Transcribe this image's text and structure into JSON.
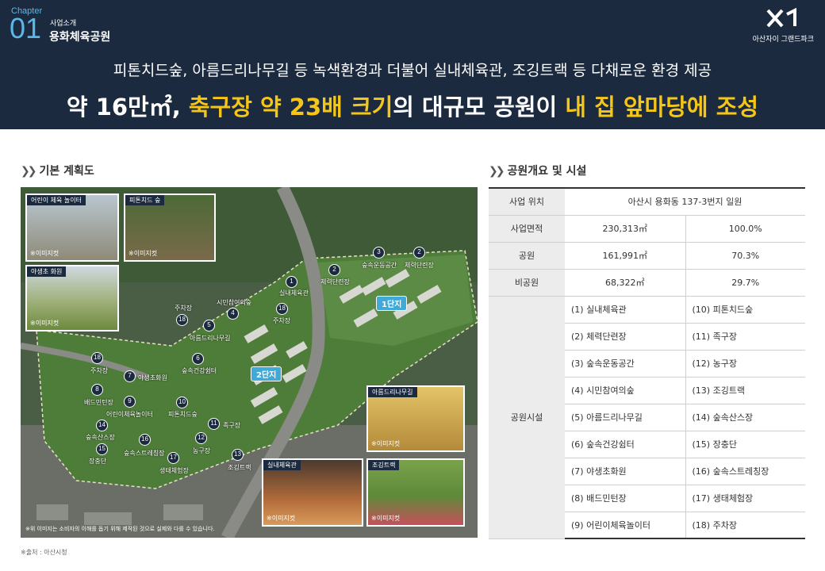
{
  "header": {
    "chapter_label": "Chapter",
    "chapter_num": "01",
    "chapter_sub": "사업소개",
    "chapter_title": "용화체육공원",
    "logo_sub": "아산자이 그랜드파크",
    "headline1": "피톤치드숲, 아름드리나무길 등 녹색환경과 더불어 실내체육관, 조깅트랙 등 다채로운 환경 제공",
    "headline2_a": "약 16만㎡, ",
    "headline2_b": "축구장 약 23배 크기",
    "headline2_c": "의 대규모 공원이 ",
    "headline2_d": "내 집 앞마당에 조성"
  },
  "colors": {
    "header_bg": "#1b2a3e",
    "accent_blue": "#5ab7e8",
    "highlight": "#f5c518",
    "complex_badge": "#3fa9d8"
  },
  "sections": {
    "left_title": "기본 계획도",
    "right_title": "공원개요 및 시설"
  },
  "map": {
    "photos": [
      {
        "tag": "어린이 체육 놀이터",
        "note": "※이미지컷"
      },
      {
        "tag": "피톤치드 숲",
        "note": "※이미지컷"
      },
      {
        "tag": "야생초 화원",
        "note": "※이미지컷"
      },
      {
        "tag": "아름드리나무길",
        "note": "※이미지컷"
      },
      {
        "tag": "실내체육관",
        "note": "※이미지컷"
      },
      {
        "tag": "조깅트랙",
        "note": "※이미지컷"
      }
    ],
    "complexes": [
      "1단지",
      "2단지"
    ],
    "markers": [
      {
        "n": "1",
        "label": "실내체육관"
      },
      {
        "n": "2",
        "label": "체력단련장"
      },
      {
        "n": "3",
        "label": "숲속운동공간"
      },
      {
        "n": "2",
        "label": "체력단련장"
      },
      {
        "n": "4",
        "label": "시민참여의숲"
      },
      {
        "n": "5",
        "label": "아름드리나무길"
      },
      {
        "n": "18",
        "label": "주차장"
      },
      {
        "n": "18",
        "label": "주차장"
      },
      {
        "n": "6",
        "label": "숲속건강쉼터"
      },
      {
        "n": "18",
        "label": "주차장"
      },
      {
        "n": "7",
        "label": "야생초화원"
      },
      {
        "n": "8",
        "label": "배드민턴장"
      },
      {
        "n": "9",
        "label": "어린이체육놀이터"
      },
      {
        "n": "10",
        "label": "피톤치드숲"
      },
      {
        "n": "11",
        "label": "족구장"
      },
      {
        "n": "12",
        "label": "농구장"
      },
      {
        "n": "13",
        "label": "조깅트랙"
      },
      {
        "n": "14",
        "label": "숲속산스장"
      },
      {
        "n": "15",
        "label": "장충단"
      },
      {
        "n": "16",
        "label": "숲속스트레칭장"
      },
      {
        "n": "17",
        "label": "생태체험장"
      }
    ],
    "note": "※위 이미지는 소비자의 이해를 돕기 위해 제작된 것으로 실제와 다를 수 있습니다."
  },
  "source": "※출처 : 아산시청",
  "table": {
    "location_label": "사업 위치",
    "location_value": "아산시 용화동 137-3번지 일원",
    "rows": [
      {
        "label": "사업면적",
        "area": "230,313㎡",
        "pct": "100.0%"
      },
      {
        "label": "공원",
        "area": "161,991㎡",
        "pct": "70.3%"
      },
      {
        "label": "비공원",
        "area": "68,322㎡",
        "pct": "29.7%"
      }
    ],
    "facilities_label": "공원시설",
    "facilities": [
      [
        "(1) 실내체육관",
        "(10) 피톤치드숲"
      ],
      [
        "(2) 체력단련장",
        "(11) 족구장"
      ],
      [
        "(3) 숲속운동공간",
        "(12) 농구장"
      ],
      [
        "(4) 시민참여의숲",
        "(13) 조깅트랙"
      ],
      [
        "(5) 아름드리나무길",
        "(14) 숲속산스장"
      ],
      [
        "(6) 숲속건강쉼터",
        "(15) 장충단"
      ],
      [
        "(7) 야생초화원",
        "(16) 숲속스트레칭장"
      ],
      [
        "(8) 배드민턴장",
        "(17) 생태체험장"
      ],
      [
        "(9) 어린이체육놀이터",
        "(18) 주차장"
      ]
    ]
  }
}
